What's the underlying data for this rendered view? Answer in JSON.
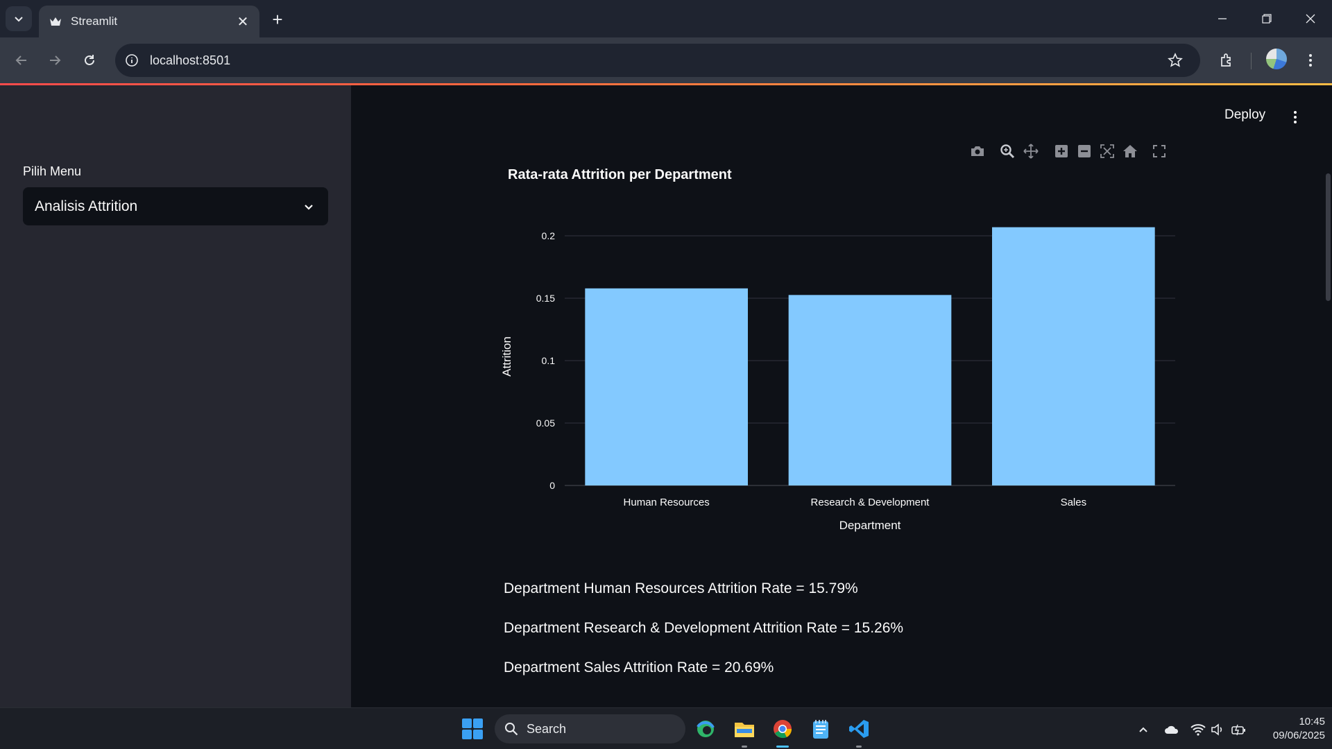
{
  "browser": {
    "tab_title": "Streamlit",
    "url": "localhost:8501",
    "new_tab_label": "+",
    "close_tab_label": "✕"
  },
  "app": {
    "deploy_label": "Deploy",
    "sidebar": {
      "label": "Pilih Menu",
      "selected": "Analisis Attrition"
    },
    "results": [
      "Department Human Resources Attrition Rate = 15.79%",
      "Department Research & Development Attrition Rate = 15.26%",
      "Department Sales Attrition Rate = 20.69%"
    ],
    "bar_color": "#83c9ff"
  },
  "chart_data": {
    "type": "bar",
    "title": "Rata-rata Attrition per Department",
    "xlabel": "Department",
    "ylabel": "Attrition",
    "categories": [
      "Human Resources",
      "Research & Development",
      "Sales"
    ],
    "values": [
      0.1579,
      0.1526,
      0.2069
    ],
    "yticks": [
      "0",
      "0.05",
      "0.1",
      "0.15",
      "0.2"
    ],
    "ytick_values": [
      0,
      0.05,
      0.1,
      0.15,
      0.2
    ],
    "ylim": [
      0,
      0.2178
    ],
    "grid": true
  },
  "taskbar": {
    "search_label": "Search",
    "time": "10:45",
    "date": "09/06/2025"
  }
}
